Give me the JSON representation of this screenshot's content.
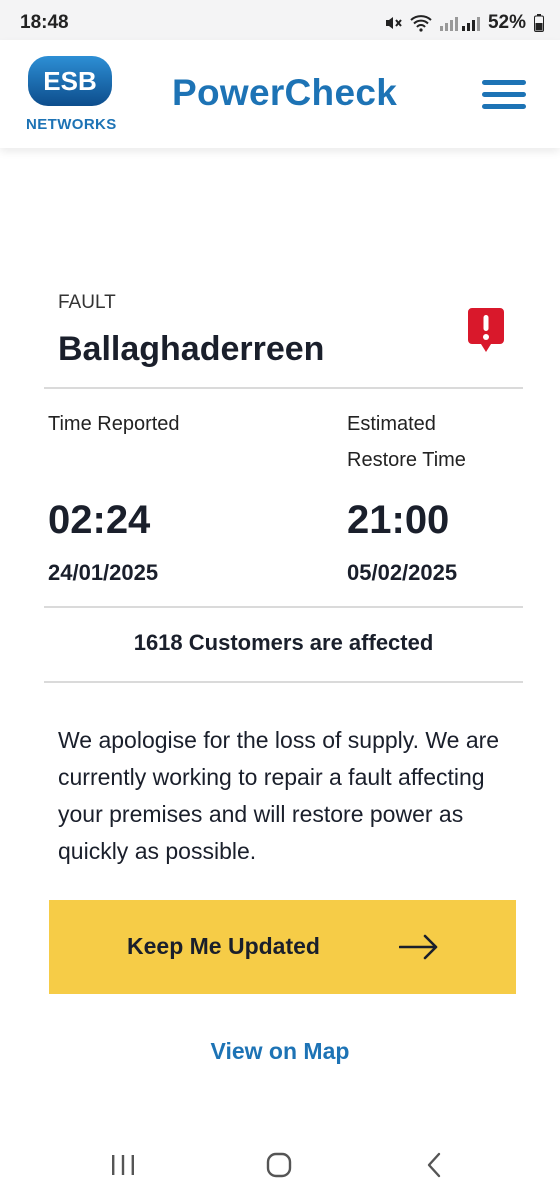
{
  "status_bar": {
    "time": "18:48",
    "battery": "52%",
    "icons": [
      "mute-icon",
      "wifi-icon",
      "signal-icon",
      "battery-icon"
    ]
  },
  "header": {
    "logo_badge_text": "ESB",
    "logo_text": "NETWORKS",
    "title": "PowerCheck",
    "menu_icon": "hamburger-menu-icon"
  },
  "fault": {
    "type_label": "FAULT",
    "location": "Ballaghaderreen",
    "alert_icon": "alert-exclamation-icon",
    "time_reported_label": "Time Reported",
    "time_reported": "02:24",
    "date_reported": "24/01/2025",
    "estimated_label_line1": "Estimated",
    "estimated_label_line2": "Restore Time",
    "restore_time": "21:00",
    "restore_date": "05/02/2025",
    "customers_affected": "1618 Customers are affected",
    "message": "We apologise for the loss of supply. We are currently working to repair a fault affecting your premises and will restore power as quickly as possible."
  },
  "actions": {
    "keep_updated_label": "Keep Me Updated",
    "keep_updated_icon": "arrow-right-icon",
    "view_map_label": "View on Map"
  },
  "nav_bar": {
    "buttons": [
      "recent-apps-icon",
      "home-icon",
      "back-icon"
    ]
  },
  "colors": {
    "brand_blue": "#1d73b5",
    "alert_red": "#d9182b",
    "button_yellow": "#f6cc47",
    "text_dark": "#1a1f2b"
  }
}
